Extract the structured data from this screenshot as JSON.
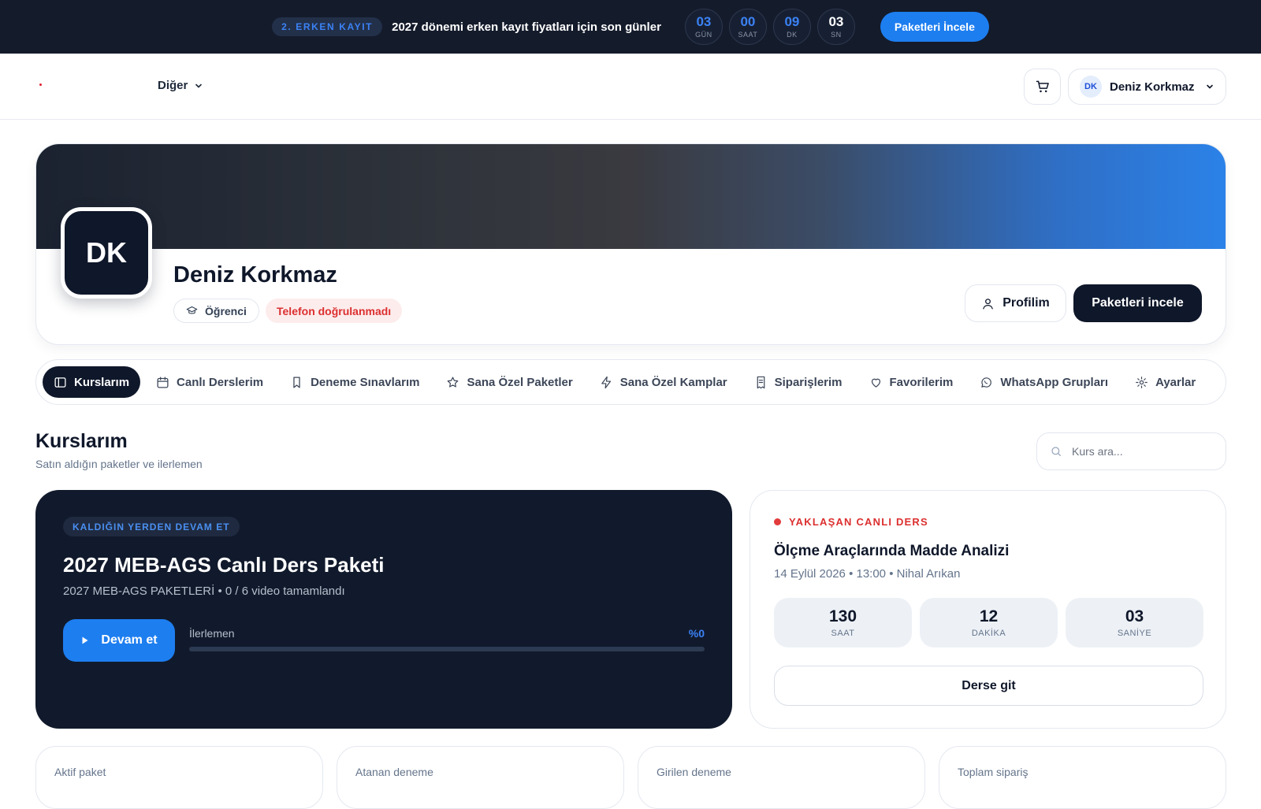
{
  "promo": {
    "badge": "2. ERKEN KAYIT",
    "text": "2027 dönemi erken kayıt fiyatları için son günler",
    "countdown": [
      {
        "value": "03",
        "label": "GÜN"
      },
      {
        "value": "00",
        "label": "SAAT"
      },
      {
        "value": "09",
        "label": "DK"
      },
      {
        "value": "03",
        "label": "SN"
      }
    ],
    "button": "Paketleri İncele"
  },
  "nav": {
    "more_label": "Diğer",
    "user_initials": "DK",
    "user_name": "Deniz Korkmaz"
  },
  "profile": {
    "initials": "DK",
    "name": "Deniz Korkmaz",
    "role_tag": "Öğrenci",
    "phone_tag": "Telefon doğrulanmadı",
    "profile_button": "Profilim",
    "packages_button": "Paketleri incele"
  },
  "tabs": [
    {
      "label": "Kurslarım",
      "icon": "sidebar-icon",
      "active": true
    },
    {
      "label": "Canlı Derslerim",
      "icon": "calendar-icon"
    },
    {
      "label": "Deneme Sınavlarım",
      "icon": "bookmark-icon"
    },
    {
      "label": "Sana Özel Paketler",
      "icon": "star-icon"
    },
    {
      "label": "Sana Özel Kamplar",
      "icon": "bolt-icon"
    },
    {
      "label": "Siparişlerim",
      "icon": "receipt-icon"
    },
    {
      "label": "Favorilerim",
      "icon": "heart-icon"
    },
    {
      "label": "WhatsApp Grupları",
      "icon": "whatsapp-icon"
    },
    {
      "label": "Ayarlar",
      "icon": "gear-icon"
    }
  ],
  "section": {
    "title": "Kurslarım",
    "subtitle": "Satın aldığın paketler ve ilerlemen",
    "search_placeholder": "Kurs ara..."
  },
  "continue_card": {
    "badge": "KALDIĞIN YERDEN DEVAM ET",
    "title": "2027 MEB-AGS Canlı Ders Paketi",
    "subtitle": "2027 MEB-AGS PAKETLERİ • 0 / 6 video tamamlandı",
    "button": "Devam et",
    "progress_label": "İlerlemen",
    "progress_text": "%0",
    "progress_fraction": 0
  },
  "live_card": {
    "badge": "YAKLAŞAN CANLI DERS",
    "title": "Ölçme Araçlarında Madde Analizi",
    "meta": "14 Eylül 2026 • 13:00 • Nihal Arıkan",
    "countdown": [
      {
        "value": "130",
        "label": "SAAT"
      },
      {
        "value": "12",
        "label": "DAKİKA"
      },
      {
        "value": "03",
        "label": "SANİYE"
      }
    ],
    "button": "Derse git"
  },
  "stats": [
    {
      "label": "Aktif paket"
    },
    {
      "label": "Atanan deneme"
    },
    {
      "label": "Girilen deneme"
    },
    {
      "label": "Toplam sipariş"
    }
  ],
  "colors": {
    "accent": "#1d7ef0",
    "dark": "#0f172a",
    "danger": "#dc2f2f"
  }
}
